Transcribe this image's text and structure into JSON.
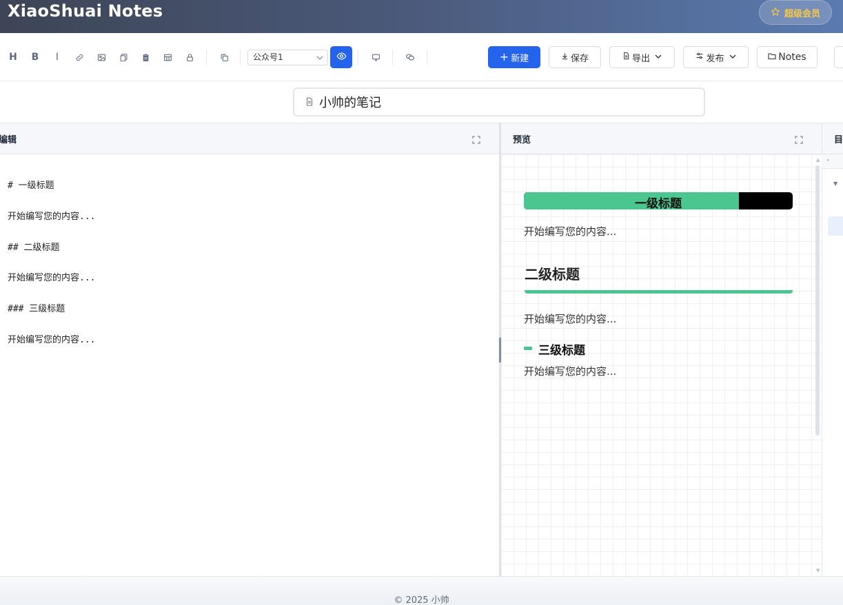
{
  "app": {
    "title": "XiaoShuai Notes",
    "vip_label": "超级会员",
    "colors": {
      "accent": "#2463eb",
      "heading_green": "#4cc690",
      "vip_gold": "#f7c948"
    }
  },
  "toolbar": {
    "format_icons": [
      {
        "name": "heading-icon",
        "glyph": "H"
      },
      {
        "name": "bold-icon",
        "glyph": "B"
      },
      {
        "name": "italic-icon",
        "glyph": "I"
      },
      {
        "name": "link-icon",
        "glyph": ""
      },
      {
        "name": "image-icon",
        "glyph": ""
      },
      {
        "name": "copy-icon",
        "glyph": ""
      },
      {
        "name": "clipboard-icon",
        "glyph": ""
      },
      {
        "name": "table-icon",
        "glyph": ""
      },
      {
        "name": "lock-icon",
        "glyph": ""
      },
      {
        "name": "duplicate-icon",
        "glyph": ""
      }
    ],
    "account_select": {
      "value": "公众号1"
    },
    "new_label": "新建",
    "save_label": "保存",
    "export_label": "导出",
    "publish_label": "发布",
    "notes_label": "Notes"
  },
  "document": {
    "title": "小帅的笔记"
  },
  "editor": {
    "label": "编辑",
    "lines": [
      "# 一级标题",
      "开始编写您的内容...",
      "## 二级标题",
      "开始编写您的内容...",
      "### 三级标题",
      "开始编写您的内容..."
    ]
  },
  "preview": {
    "label": "预览",
    "h1": "一级标题",
    "p1": "开始编写您的内容...",
    "h2": "二级标题",
    "p2": "开始编写您的内容...",
    "h3": "三级标题",
    "p3": "开始编写您的内容..."
  },
  "toc": {
    "label": "目"
  },
  "footer": {
    "copyright": "© 2025 小帅"
  }
}
